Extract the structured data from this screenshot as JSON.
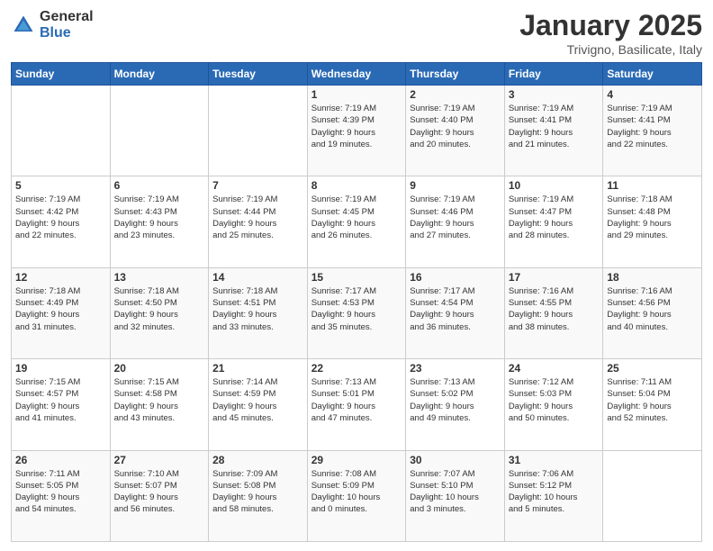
{
  "logo": {
    "general": "General",
    "blue": "Blue"
  },
  "title": {
    "month": "January 2025",
    "location": "Trivigno, Basilicate, Italy"
  },
  "weekdays": [
    "Sunday",
    "Monday",
    "Tuesday",
    "Wednesday",
    "Thursday",
    "Friday",
    "Saturday"
  ],
  "weeks": [
    [
      {
        "date": "",
        "info": ""
      },
      {
        "date": "",
        "info": ""
      },
      {
        "date": "",
        "info": ""
      },
      {
        "date": "1",
        "info": "Sunrise: 7:19 AM\nSunset: 4:39 PM\nDaylight: 9 hours\nand 19 minutes."
      },
      {
        "date": "2",
        "info": "Sunrise: 7:19 AM\nSunset: 4:40 PM\nDaylight: 9 hours\nand 20 minutes."
      },
      {
        "date": "3",
        "info": "Sunrise: 7:19 AM\nSunset: 4:41 PM\nDaylight: 9 hours\nand 21 minutes."
      },
      {
        "date": "4",
        "info": "Sunrise: 7:19 AM\nSunset: 4:41 PM\nDaylight: 9 hours\nand 22 minutes."
      }
    ],
    [
      {
        "date": "5",
        "info": "Sunrise: 7:19 AM\nSunset: 4:42 PM\nDaylight: 9 hours\nand 22 minutes."
      },
      {
        "date": "6",
        "info": "Sunrise: 7:19 AM\nSunset: 4:43 PM\nDaylight: 9 hours\nand 23 minutes."
      },
      {
        "date": "7",
        "info": "Sunrise: 7:19 AM\nSunset: 4:44 PM\nDaylight: 9 hours\nand 25 minutes."
      },
      {
        "date": "8",
        "info": "Sunrise: 7:19 AM\nSunset: 4:45 PM\nDaylight: 9 hours\nand 26 minutes."
      },
      {
        "date": "9",
        "info": "Sunrise: 7:19 AM\nSunset: 4:46 PM\nDaylight: 9 hours\nand 27 minutes."
      },
      {
        "date": "10",
        "info": "Sunrise: 7:19 AM\nSunset: 4:47 PM\nDaylight: 9 hours\nand 28 minutes."
      },
      {
        "date": "11",
        "info": "Sunrise: 7:18 AM\nSunset: 4:48 PM\nDaylight: 9 hours\nand 29 minutes."
      }
    ],
    [
      {
        "date": "12",
        "info": "Sunrise: 7:18 AM\nSunset: 4:49 PM\nDaylight: 9 hours\nand 31 minutes."
      },
      {
        "date": "13",
        "info": "Sunrise: 7:18 AM\nSunset: 4:50 PM\nDaylight: 9 hours\nand 32 minutes."
      },
      {
        "date": "14",
        "info": "Sunrise: 7:18 AM\nSunset: 4:51 PM\nDaylight: 9 hours\nand 33 minutes."
      },
      {
        "date": "15",
        "info": "Sunrise: 7:17 AM\nSunset: 4:53 PM\nDaylight: 9 hours\nand 35 minutes."
      },
      {
        "date": "16",
        "info": "Sunrise: 7:17 AM\nSunset: 4:54 PM\nDaylight: 9 hours\nand 36 minutes."
      },
      {
        "date": "17",
        "info": "Sunrise: 7:16 AM\nSunset: 4:55 PM\nDaylight: 9 hours\nand 38 minutes."
      },
      {
        "date": "18",
        "info": "Sunrise: 7:16 AM\nSunset: 4:56 PM\nDaylight: 9 hours\nand 40 minutes."
      }
    ],
    [
      {
        "date": "19",
        "info": "Sunrise: 7:15 AM\nSunset: 4:57 PM\nDaylight: 9 hours\nand 41 minutes."
      },
      {
        "date": "20",
        "info": "Sunrise: 7:15 AM\nSunset: 4:58 PM\nDaylight: 9 hours\nand 43 minutes."
      },
      {
        "date": "21",
        "info": "Sunrise: 7:14 AM\nSunset: 4:59 PM\nDaylight: 9 hours\nand 45 minutes."
      },
      {
        "date": "22",
        "info": "Sunrise: 7:13 AM\nSunset: 5:01 PM\nDaylight: 9 hours\nand 47 minutes."
      },
      {
        "date": "23",
        "info": "Sunrise: 7:13 AM\nSunset: 5:02 PM\nDaylight: 9 hours\nand 49 minutes."
      },
      {
        "date": "24",
        "info": "Sunrise: 7:12 AM\nSunset: 5:03 PM\nDaylight: 9 hours\nand 50 minutes."
      },
      {
        "date": "25",
        "info": "Sunrise: 7:11 AM\nSunset: 5:04 PM\nDaylight: 9 hours\nand 52 minutes."
      }
    ],
    [
      {
        "date": "26",
        "info": "Sunrise: 7:11 AM\nSunset: 5:05 PM\nDaylight: 9 hours\nand 54 minutes."
      },
      {
        "date": "27",
        "info": "Sunrise: 7:10 AM\nSunset: 5:07 PM\nDaylight: 9 hours\nand 56 minutes."
      },
      {
        "date": "28",
        "info": "Sunrise: 7:09 AM\nSunset: 5:08 PM\nDaylight: 9 hours\nand 58 minutes."
      },
      {
        "date": "29",
        "info": "Sunrise: 7:08 AM\nSunset: 5:09 PM\nDaylight: 10 hours\nand 0 minutes."
      },
      {
        "date": "30",
        "info": "Sunrise: 7:07 AM\nSunset: 5:10 PM\nDaylight: 10 hours\nand 3 minutes."
      },
      {
        "date": "31",
        "info": "Sunrise: 7:06 AM\nSunset: 5:12 PM\nDaylight: 10 hours\nand 5 minutes."
      },
      {
        "date": "",
        "info": ""
      }
    ]
  ]
}
